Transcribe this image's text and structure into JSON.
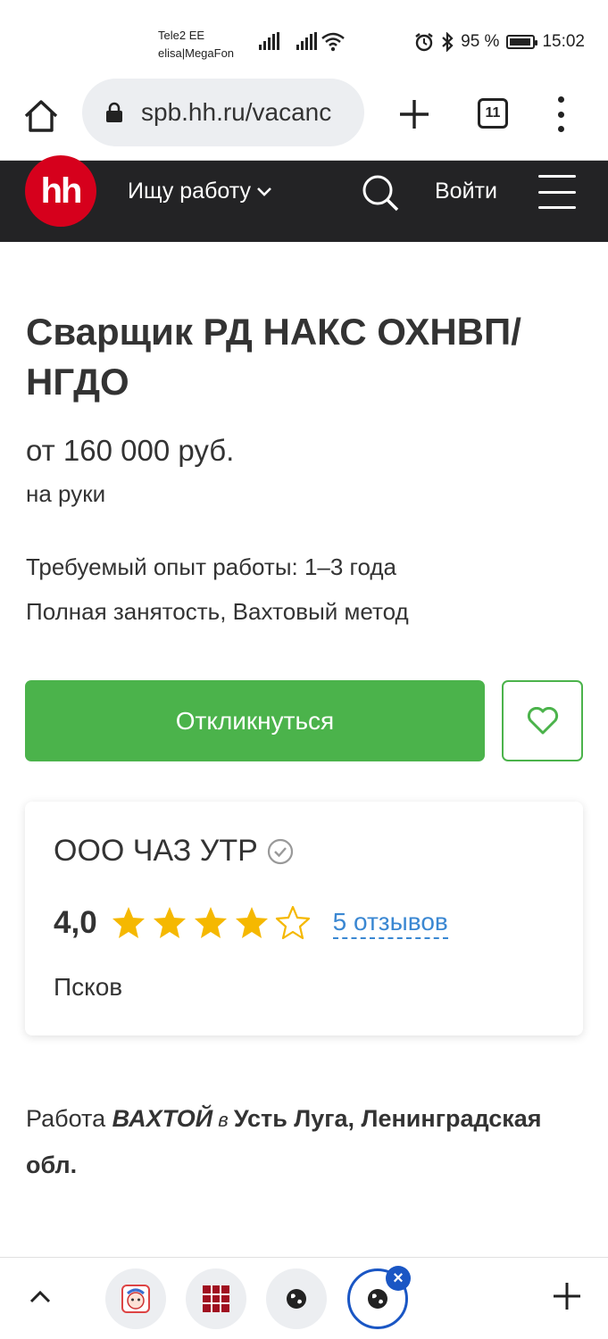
{
  "status_bar": {
    "carrier_1": "Tele2 EE",
    "carrier_2": "elisa|MegaFon",
    "battery_percent": "95 %",
    "battery_level": 0.95,
    "time": "15:02",
    "icons": [
      "signal-icon",
      "wifi-icon",
      "alarm-icon",
      "bluetooth-icon",
      "battery-icon"
    ]
  },
  "browser": {
    "url": "spb.hh.ru/vacanc",
    "tab_count": "11"
  },
  "site_header": {
    "logo": "hh",
    "job_menu_label": "Ищу работу",
    "login_label": "Войти",
    "brand_color": "#d6001c",
    "header_bg": "#232325"
  },
  "vacancy": {
    "title": "Сварщик РД НАКС ОХНВП/ НГДО",
    "salary": "от 160 000 руб.",
    "salary_note": "на руки",
    "experience": "Требуемый опыт работы: 1–3 года",
    "employment": "Полная занятость, Вахтовый метод",
    "apply_label": "Откликнуться",
    "accent_color": "#4bb34b"
  },
  "company": {
    "name": "ООО ЧАЗ УТР",
    "rating": "4,0",
    "rating_stars": 4,
    "rating_max": 5,
    "reviews_label": "5 отзывов",
    "city": "Псков",
    "star_color": "#f5b800",
    "link_color": "#3a87d2"
  },
  "promo": {
    "prefix": "Работа ",
    "highlight": "ВАХТОЙ",
    "conj": " в ",
    "place": "Усть Луга, Ленинградская обл."
  },
  "bottom_bar": {
    "tabs": [
      "site-favicon-kid",
      "site-favicon-grid",
      "globe-icon",
      "globe-icon"
    ],
    "active_color": "#1a56c4"
  }
}
